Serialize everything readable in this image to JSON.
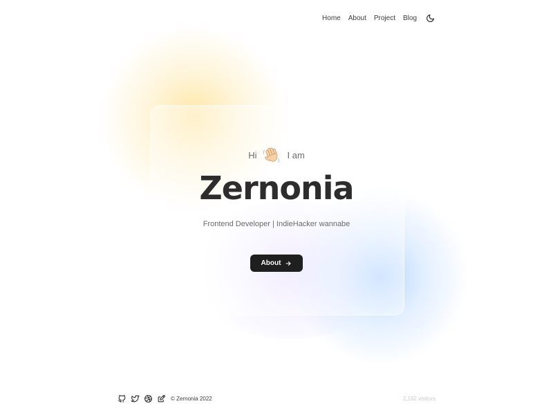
{
  "nav": {
    "items": [
      {
        "label": "Home",
        "active": true
      },
      {
        "label": "About",
        "active": false
      },
      {
        "label": "Project",
        "active": false
      },
      {
        "label": "Blog",
        "active": false
      }
    ],
    "theme_toggle_icon": "moon-icon"
  },
  "hero": {
    "greeting_before": "Hi",
    "greeting_emoji_icon": "waving-hand-icon",
    "greeting_after": "I am",
    "name": "Zernonia",
    "tagline": "Frontend Developer | IndieHacker wannabe",
    "cta_label": "About",
    "cta_icon": "arrow-right-icon"
  },
  "footer": {
    "social_icons": [
      "github-icon",
      "twitter-icon",
      "dribbble-icon",
      "edit-icon"
    ],
    "copyright": "© Zernonia 2022",
    "visitors": "2,162 visitors"
  },
  "colors": {
    "accent_yellow": "#fcd86e",
    "accent_blue": "#8cbeff",
    "accent_purple": "#d6c8ff",
    "button_bg": "#1f1f1f",
    "text_dark": "#2d2d2d"
  }
}
